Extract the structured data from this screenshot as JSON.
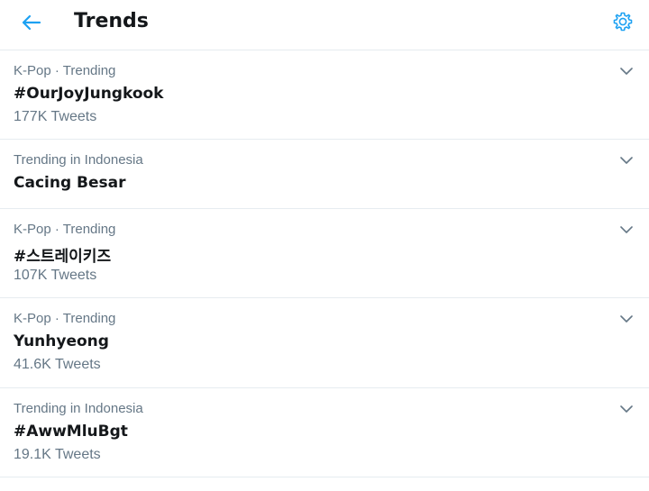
{
  "header": {
    "title": "Trends",
    "back_icon": "arrow-left-icon",
    "settings_icon": "gear-icon",
    "accent_color": "#1da1f2"
  },
  "trends": [
    {
      "context": "K-Pop · Trending",
      "name": "#OurJoyJungkook",
      "count": "177K Tweets"
    },
    {
      "context": "Trending in Indonesia",
      "name": "Cacing Besar",
      "count": ""
    },
    {
      "context": "K-Pop · Trending",
      "name": "#스트레이키즈",
      "count": "107K Tweets"
    },
    {
      "context": "K-Pop · Trending",
      "name": "Yunhyeong",
      "count": "41.6K Tweets"
    },
    {
      "context": "Trending in Indonesia",
      "name": "#AwwMluBgt",
      "count": "19.1K Tweets"
    }
  ],
  "colors": {
    "text_primary": "#14171a",
    "text_secondary": "#657786",
    "divider": "#e6ecf0"
  }
}
